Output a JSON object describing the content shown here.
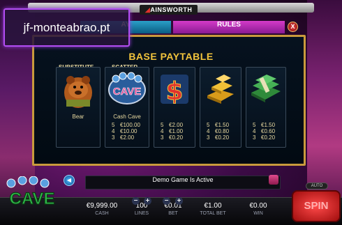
{
  "brand": {
    "label": "AINSWORTH"
  },
  "watermark": {
    "text": "jf-monteabrao.pt"
  },
  "tabs": {
    "play": "AY",
    "rules": "RULES"
  },
  "close": {
    "label": "X"
  },
  "paytable": {
    "title": "BASE PAYTABLE",
    "symbols": [
      {
        "header": "SUBSTITUTE",
        "name": "Bear",
        "icon": "bear-icon",
        "pays": []
      },
      {
        "header": "SCATTER",
        "name": "Cash Cave",
        "icon": "cash-cave-icon",
        "pays": [
          {
            "n": "5",
            "v": "€100.00"
          },
          {
            "n": "4",
            "v": "€10.00"
          },
          {
            "n": "3",
            "v": "€2.00"
          }
        ]
      },
      {
        "header": "",
        "name": "",
        "icon": "dollar-sign-icon",
        "pays": [
          {
            "n": "5",
            "v": "€2.00"
          },
          {
            "n": "4",
            "v": "€1.00"
          },
          {
            "n": "3",
            "v": "€0.20"
          }
        ]
      },
      {
        "header": "",
        "name": "",
        "icon": "gold-bars-icon",
        "pays": [
          {
            "n": "5",
            "v": "€1.50"
          },
          {
            "n": "4",
            "v": "€0.80"
          },
          {
            "n": "3",
            "v": "€0.20"
          }
        ]
      },
      {
        "header": "",
        "name": "",
        "icon": "cash-stack-icon",
        "pays": [
          {
            "n": "5",
            "v": "€1.50"
          },
          {
            "n": "4",
            "v": "€0.60"
          },
          {
            "n": "3",
            "v": "€0.20"
          }
        ]
      }
    ]
  },
  "banner": {
    "text": "Demo Game Is Active"
  },
  "bottom": {
    "cash": {
      "value": "€9,999.00",
      "label": "CASH"
    },
    "lines": {
      "value": "100",
      "label": "LINES"
    },
    "bet": {
      "value": "€0.01",
      "label": "BET"
    },
    "total_bet": {
      "value": "€1.00",
      "label": "TOTAL BET"
    },
    "win": {
      "value": "€0.00",
      "label": "WIN"
    },
    "stepper_minus": "−",
    "stepper_plus": "+"
  },
  "logo": {
    "text": "CAVE",
    "icon": "cash-cave-logo"
  },
  "auto": {
    "label": "AUTO"
  },
  "spin": {
    "label": "SPIN"
  },
  "colors": {
    "accent": "#f2c43c",
    "panel_border": "#c99a3c",
    "rules_tab": "#c22fb5",
    "play_tab": "#1c86b0"
  }
}
